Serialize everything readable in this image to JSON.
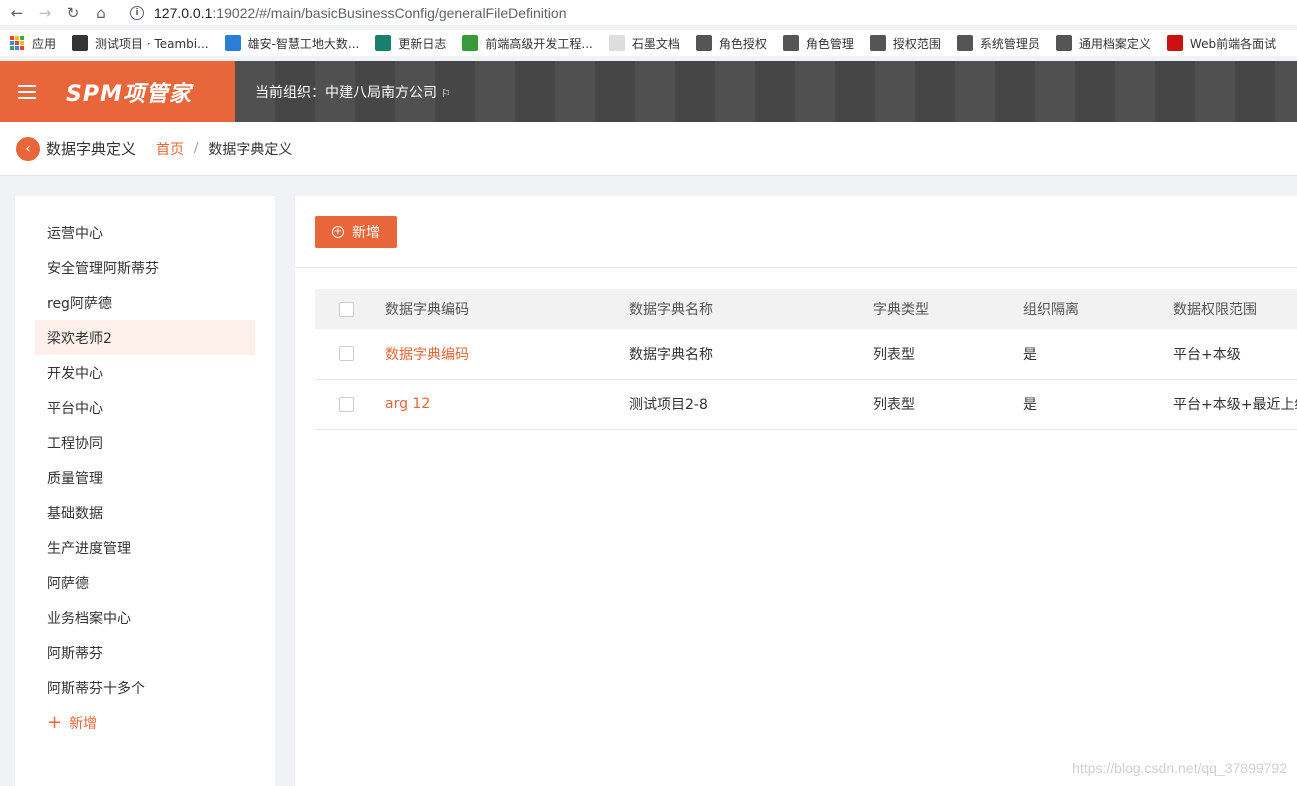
{
  "browser": {
    "url_host": "127.0.0.1",
    "url_rest": ":19022/#/main/basicBusinessConfig/generalFileDefinition",
    "bookmarks": [
      {
        "label": "应用",
        "color": "#e8663a"
      },
      {
        "label": "测试项目 · Teambi...",
        "color": "#333333"
      },
      {
        "label": "雄安-智慧工地大数...",
        "color": "#2b7ed8"
      },
      {
        "label": "更新日志",
        "color": "#1a7f6e"
      },
      {
        "label": "前端高级开发工程...",
        "color": "#3a9a3a"
      },
      {
        "label": "石墨文档",
        "color": "#dddddd"
      },
      {
        "label": "角色授权",
        "color": "#555555"
      },
      {
        "label": "角色管理",
        "color": "#555555"
      },
      {
        "label": "授权范围",
        "color": "#555555"
      },
      {
        "label": "系统管理员",
        "color": "#555555"
      },
      {
        "label": "通用档案定义",
        "color": "#555555"
      },
      {
        "label": "Web前端各面试",
        "color": "#cc1111"
      }
    ]
  },
  "header": {
    "logo": "SPM项管家",
    "org_label": "当前组织：中建八局南方公司",
    "accent": "#e8663a"
  },
  "breadcrumb": {
    "title": "数据字典定义",
    "home": "首页",
    "separator": "/",
    "current": "数据字典定义"
  },
  "sidebar": {
    "items": [
      {
        "label": "运营中心",
        "active": false
      },
      {
        "label": "安全管理阿斯蒂芬",
        "active": false
      },
      {
        "label": "reg阿萨德",
        "active": false
      },
      {
        "label": "梁欢老师2",
        "active": true
      },
      {
        "label": "开发中心",
        "active": false
      },
      {
        "label": "平台中心",
        "active": false
      },
      {
        "label": "工程协同",
        "active": false
      },
      {
        "label": "质量管理",
        "active": false
      },
      {
        "label": "基础数据",
        "active": false
      },
      {
        "label": "生产进度管理",
        "active": false
      },
      {
        "label": "阿萨德",
        "active": false
      },
      {
        "label": "业务档案中心",
        "active": false
      },
      {
        "label": "阿斯蒂芬",
        "active": false
      },
      {
        "label": "阿斯蒂芬十多个",
        "active": false
      }
    ],
    "add_label": "新增"
  },
  "main": {
    "add_button": "新增",
    "columns": [
      "数据字典编码",
      "数据字典名称",
      "字典类型",
      "组织隔离",
      "数据权限范围"
    ],
    "rows": [
      {
        "code": "数据字典编码",
        "name": "数据字典名称",
        "type": "列表型",
        "isolation": "是",
        "scope": "平台+本级"
      },
      {
        "code": "arg 12",
        "name": "测试项目2-8",
        "type": "列表型",
        "isolation": "是",
        "scope": "平台+本级+最近上级"
      }
    ]
  },
  "watermark": "https://blog.csdn.net/qq_37899792"
}
